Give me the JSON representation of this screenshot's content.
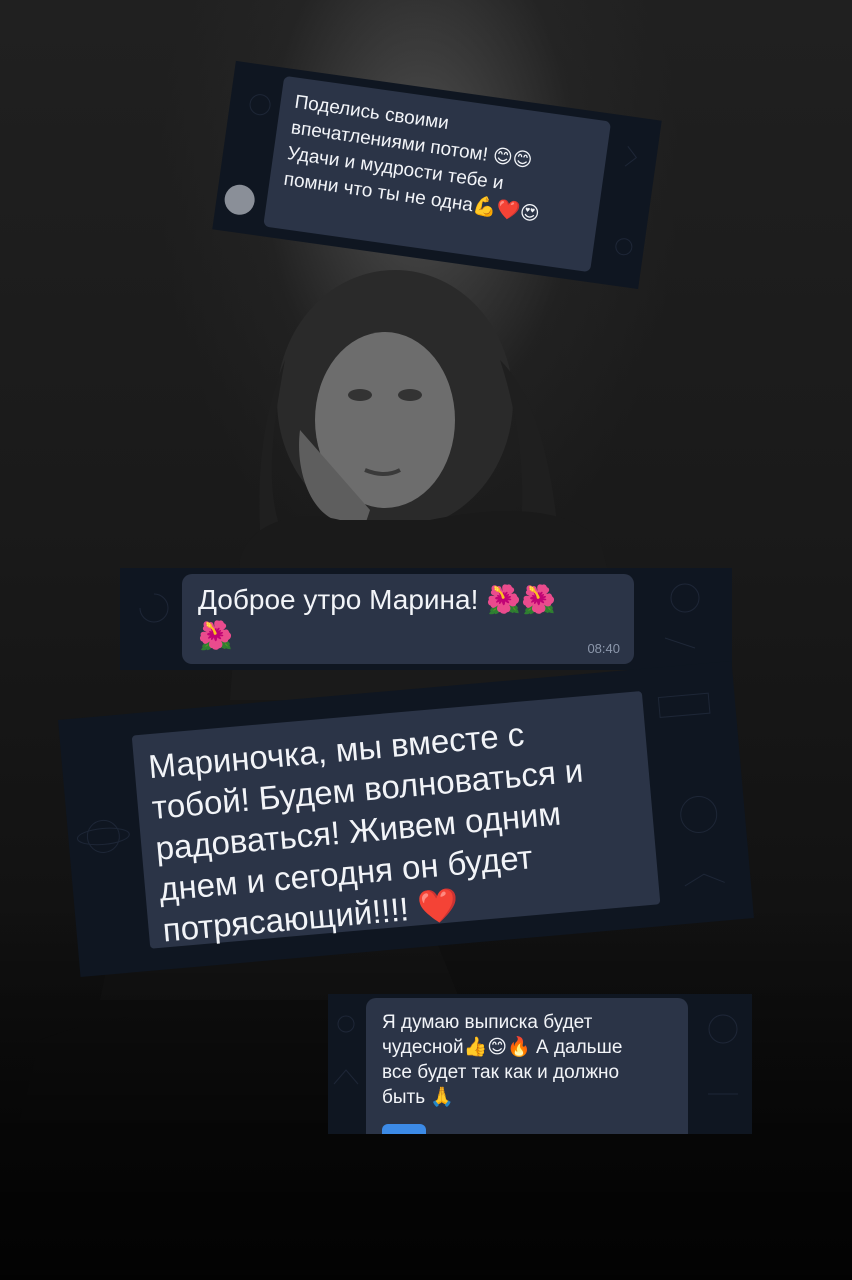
{
  "messages": [
    {
      "id": "msg-1",
      "text": "Поделись своими\nвпечатлениями потом! 😊😊\nУдачи и  мудрости тебе и\nпомни что ты не одна💪❤️😍"
    },
    {
      "id": "msg-2",
      "text": "Доброе утро Марина! 🌺🌺\n🌺",
      "time": "08:40"
    },
    {
      "id": "msg-3",
      "text": "Мариночка, мы вместе с\nтобой! Будем волноваться и\nрадоваться! Живем одним\nднем и сегодня он будет\nпотрясающий!!!! ❤️"
    },
    {
      "id": "msg-4",
      "text": "Я думаю выписка будет\nчудесной👍😊🔥 А дальше\nвсе будет так как и должно\nбыть 🙏"
    }
  ],
  "colors": {
    "bubble": "#2b3447",
    "chat_background": "#0f1621",
    "text": "#f2f4f8",
    "time": "#8c97ab"
  }
}
